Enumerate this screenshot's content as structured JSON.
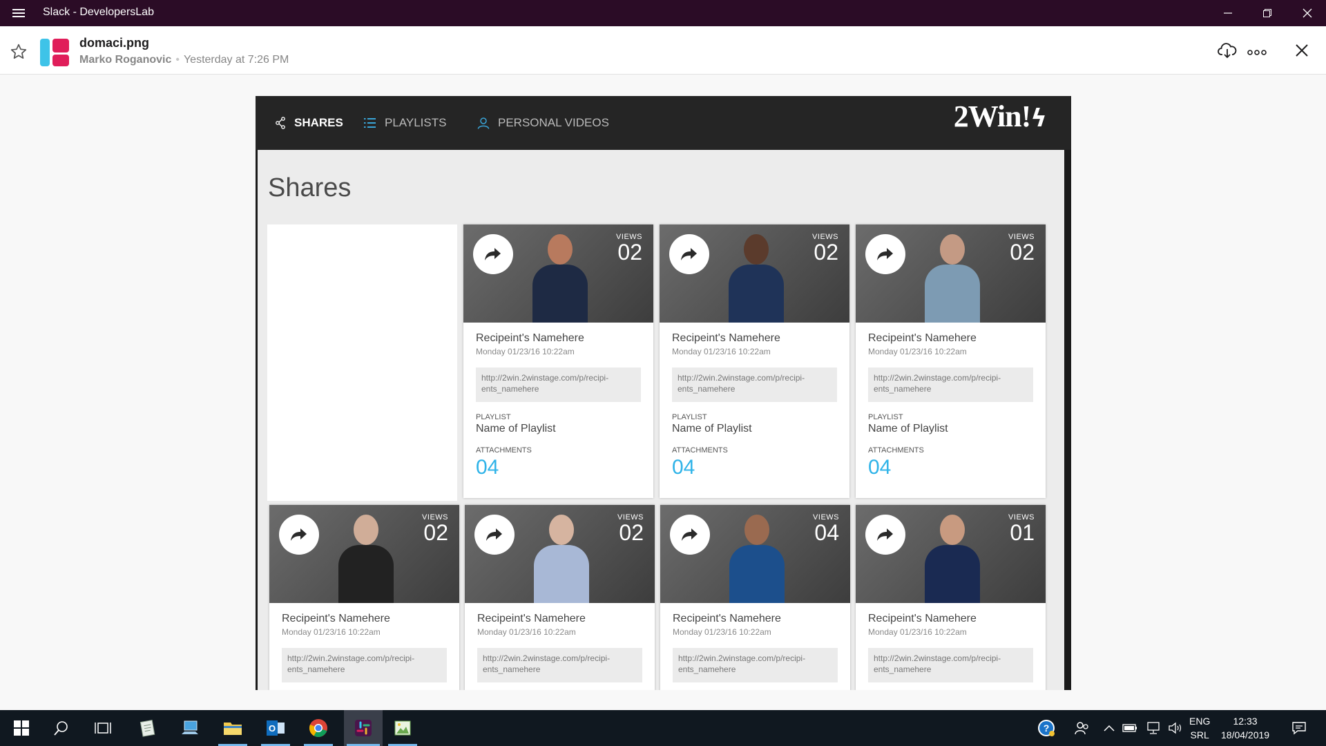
{
  "window": {
    "title": "Slack - DevelopersLab"
  },
  "file": {
    "name": "domaci.png",
    "author": "Marko Roganovic",
    "time": "Yesterday at 7:26 PM"
  },
  "app": {
    "nav": [
      {
        "label": "SHARES",
        "icon": "share-icon"
      },
      {
        "label": "PLAYLISTS",
        "icon": "list-icon"
      },
      {
        "label": "PERSONAL VIDEOS",
        "icon": "user-icon"
      }
    ],
    "logo": "2Win!",
    "page_title": "Shares",
    "labels": {
      "views": "VIEWS",
      "playlist": "PLAYLIST",
      "attachments": "ATTACHMENTS"
    },
    "cards": [
      {
        "views": "02",
        "name": "Recipeint's Namehere",
        "date": "Monday 01/23/16 10:22am",
        "url": "http://2win.2winstage.com/p/recipi-ents_namehere",
        "playlist": "Name of Playlist",
        "attachments": "04"
      },
      {
        "views": "02",
        "name": "Recipeint's Namehere",
        "date": "Monday 01/23/16 10:22am",
        "url": "http://2win.2winstage.com/p/recipi-ents_namehere",
        "playlist": "Name of Playlist",
        "attachments": "04"
      },
      {
        "views": "02",
        "name": "Recipeint's Namehere",
        "date": "Monday 01/23/16 10:22am",
        "url": "http://2win.2winstage.com/p/recipi-ents_namehere",
        "playlist": "Name of Playlist",
        "attachments": "04"
      },
      {
        "views": "02",
        "name": "Recipeint's Namehere",
        "date": "Monday 01/23/16 10:22am",
        "url": "http://2win.2winstage.com/p/recipi-ents_namehere"
      },
      {
        "views": "02",
        "name": "Recipeint's Namehere",
        "date": "Monday 01/23/16 10:22am",
        "url": "http://2win.2winstage.com/p/recipi-ents_namehere"
      },
      {
        "views": "04",
        "name": "Recipeint's Namehere",
        "date": "Monday 01/23/16 10:22am",
        "url": "http://2win.2winstage.com/p/recipi-ents_namehere"
      },
      {
        "views": "01",
        "name": "Recipeint's Namehere",
        "date": "Monday 01/23/16 10:22am",
        "url": "http://2win.2winstage.com/p/recipi-ents_namehere"
      }
    ]
  },
  "taskbar": {
    "lang": "ENG",
    "layout": "SRL",
    "time": "12:33",
    "date": "18/04/2019"
  },
  "colors": {
    "titlebar": "#2b0c26",
    "accent": "#2fb3e8",
    "taskbar": "#101820"
  }
}
